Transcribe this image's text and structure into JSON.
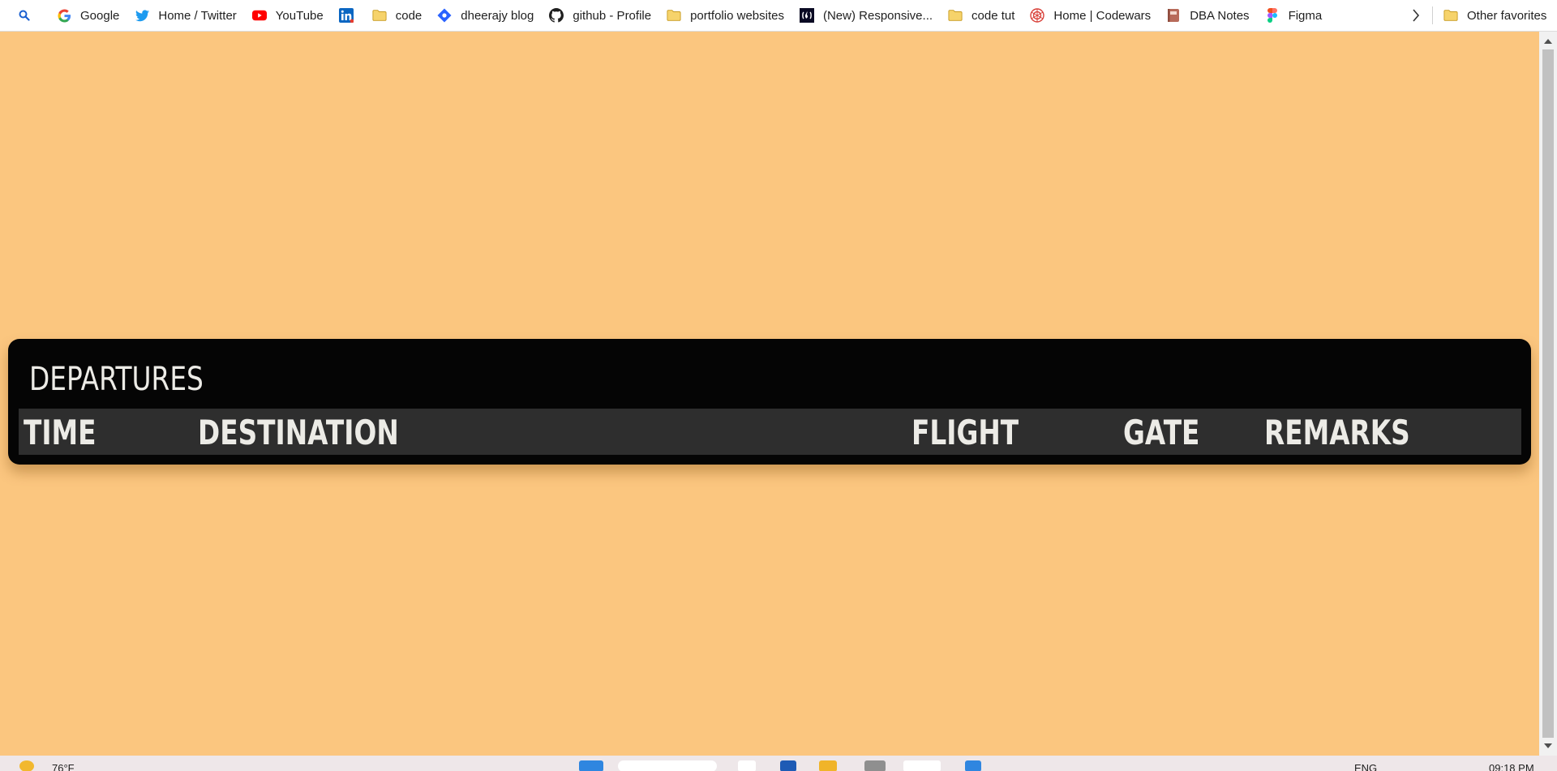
{
  "bookmarks": {
    "items": [
      {
        "label": "Google",
        "icon": "google-icon"
      },
      {
        "label": "Home / Twitter",
        "icon": "twitter-icon"
      },
      {
        "label": "YouTube",
        "icon": "youtube-icon"
      },
      {
        "label": "",
        "icon": "linkedin-icon"
      },
      {
        "label": "code",
        "icon": "folder-icon"
      },
      {
        "label": "dheerajy blog",
        "icon": "hashnode-icon"
      },
      {
        "label": "github - Profile",
        "icon": "github-icon"
      },
      {
        "label": "portfolio websites",
        "icon": "folder-icon"
      },
      {
        "label": "(New) Responsive...",
        "icon": "freecodecamp-icon"
      },
      {
        "label": "code tut",
        "icon": "folder-icon"
      },
      {
        "label": "Home | Codewars",
        "icon": "codewars-icon"
      },
      {
        "label": "DBA Notes",
        "icon": "notebook-icon"
      },
      {
        "label": "Figma",
        "icon": "figma-icon"
      }
    ],
    "other_label": "Other favorites"
  },
  "board": {
    "title": "DEPARTURES",
    "columns": [
      "TIME",
      "DESTINATION",
      "FLIGHT",
      "GATE",
      "REMARKS"
    ]
  },
  "colors": {
    "page_background": "#fbc67f",
    "board_background": "#050505",
    "header_row": "#2e2e2e",
    "board_text": "#ecebe6"
  },
  "taskbar": {
    "weather": "76°F",
    "language": "ENG",
    "time": "09:18 PM"
  }
}
